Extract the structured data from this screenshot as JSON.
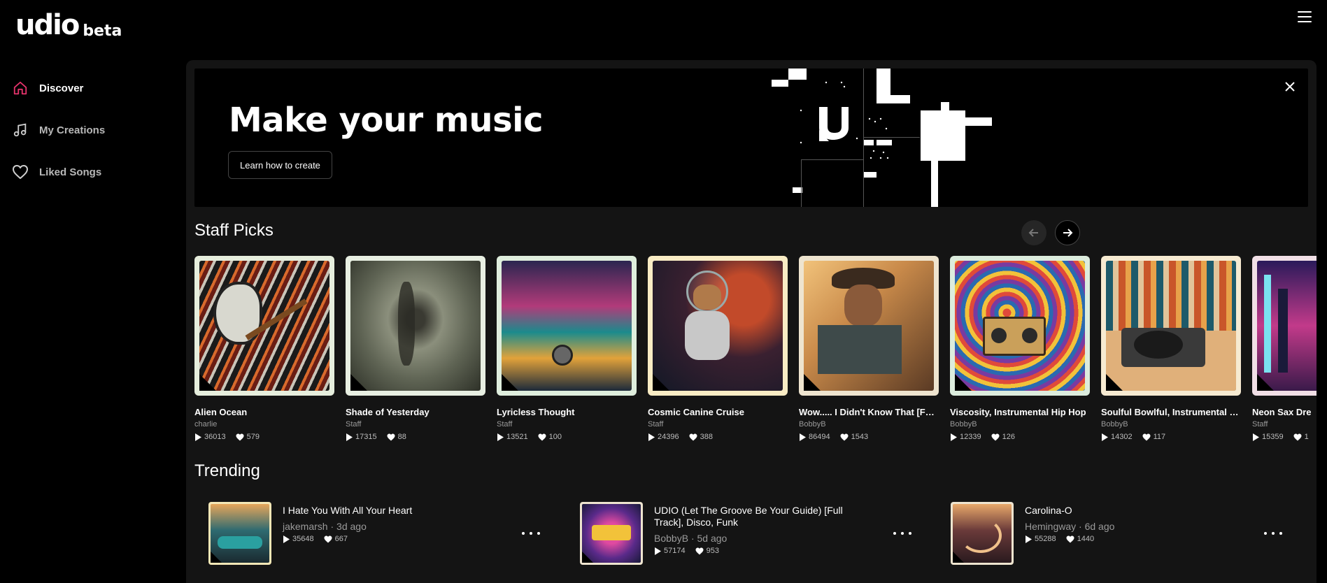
{
  "app": {
    "logo_main": "udio",
    "logo_beta": "beta"
  },
  "sidebar": {
    "items": [
      {
        "label": "Discover",
        "icon": "home-icon",
        "active": true
      },
      {
        "label": "My Creations",
        "icon": "music-note-icon",
        "active": false
      },
      {
        "label": "Liked Songs",
        "icon": "heart-icon",
        "active": false
      }
    ]
  },
  "banner": {
    "title": "Make your music",
    "button_label": "Learn how to create"
  },
  "staff_picks": {
    "title": "Staff Picks",
    "items": [
      {
        "title": "Alien Ocean",
        "artist": "charlie",
        "plays": "36013",
        "likes": "579",
        "frame": "#e6eedd"
      },
      {
        "title": "Shade of Yesterday",
        "artist": "Staff",
        "plays": "17315",
        "likes": "88",
        "frame": "#e8efe2"
      },
      {
        "title": "Lyricless Thought",
        "artist": "Staff",
        "plays": "13521",
        "likes": "100",
        "frame": "#dfeedd"
      },
      {
        "title": "Cosmic Canine Cruise",
        "artist": "Staff",
        "plays": "24396",
        "likes": "388",
        "frame": "#f9ecc4"
      },
      {
        "title": "Wow..... I Didn't Know That [Full...",
        "artist": "BobbyB",
        "plays": "86494",
        "likes": "1543",
        "frame": "#eee4cf"
      },
      {
        "title": "Viscosity, Instrumental Hip Hop",
        "artist": "BobbyB",
        "plays": "12339",
        "likes": "126",
        "frame": "#dcecdd"
      },
      {
        "title": "Soulful Bowlful, Instrumental Hi...",
        "artist": "BobbyB",
        "plays": "14302",
        "likes": "117",
        "frame": "#f6ead1"
      },
      {
        "title": "Neon Sax Dre",
        "artist": "Staff",
        "plays": "15359",
        "likes": "1",
        "frame": "#f1dfe6"
      }
    ]
  },
  "trending": {
    "title": "Trending",
    "items": [
      {
        "title": "I Hate You With All Your Heart",
        "artist": "jakemarsh",
        "age": "3d ago",
        "plays": "35648",
        "likes": "667"
      },
      {
        "title": "UDIO (Let The Groove Be Your Guide) [Full Track], Disco, Funk",
        "artist": "BobbyB",
        "age": "5d ago",
        "plays": "57174",
        "likes": "953"
      },
      {
        "title": "Carolina-O",
        "artist": "Hemingway",
        "age": "6d ago",
        "plays": "55288",
        "likes": "1440"
      }
    ]
  },
  "meta_sep": "·",
  "colors": {
    "accent": "#e5336b",
    "background": "#000000",
    "panel": "#141414"
  }
}
